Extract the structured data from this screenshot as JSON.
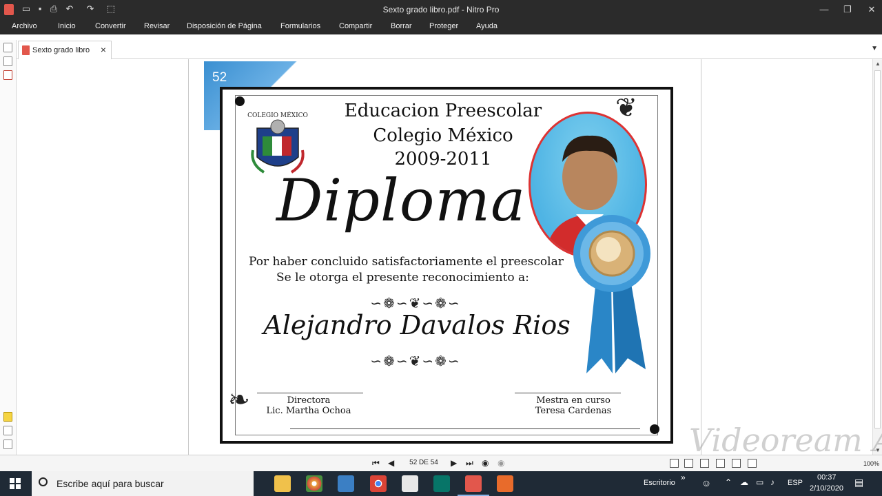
{
  "window": {
    "title": "Sexto grado libro.pdf - Nitro Pro",
    "controls": [
      "minimize-icon",
      "restore-icon",
      "close-icon"
    ]
  },
  "quick_access": [
    "open-folder-icon",
    "save-icon",
    "print-icon",
    "undo-icon",
    "redo-icon",
    "select-tool-icon"
  ],
  "menu": [
    "Archivo",
    "Inicio",
    "Convertir",
    "Revisar",
    "Disposición de Página",
    "Formularios",
    "Compartir",
    "Borrar",
    "Proteger",
    "Ayuda"
  ],
  "tabs": [
    {
      "label": "Sexto grado libro",
      "close": "×"
    }
  ],
  "page_badge": "52",
  "diploma": {
    "heading1": "Educacion Preescolar",
    "heading2": "Colegio México",
    "heading3": "2009-2011",
    "title": "Diploma",
    "line1": "Por haber concluido satisfactoriamente el preescolar",
    "line2": "Se le otorga el presente reconocimiento a:",
    "recipient": "Alejandro Davalos Rios",
    "crest_text": "COLEGIO MÉXICO",
    "signatures": [
      {
        "role": "Directora",
        "name": "Lic. Martha Ochoa"
      },
      {
        "role": "Mestra en curso",
        "name": "Teresa Cardenas"
      }
    ]
  },
  "navigation": {
    "page_indicator": "52 DE 54",
    "zoom": "100%"
  },
  "taskbar": {
    "search_placeholder": "Escribe aquí para buscar",
    "desktop_label": "Escritorio",
    "language": "ESP",
    "time": "00:37",
    "date": "2/10/2020",
    "apps": [
      "file-explorer-icon",
      "chrome-canary-icon",
      "photos-icon",
      "chrome-icon",
      "calendar-icon",
      "publisher-icon",
      "nitro-icon",
      "presentation-icon"
    ]
  },
  "watermark": "Videoream APPS",
  "colors": {
    "titlebar": "#2b2b2b",
    "accent": "#3a8fd1",
    "taskbar": "#1f2a36"
  }
}
